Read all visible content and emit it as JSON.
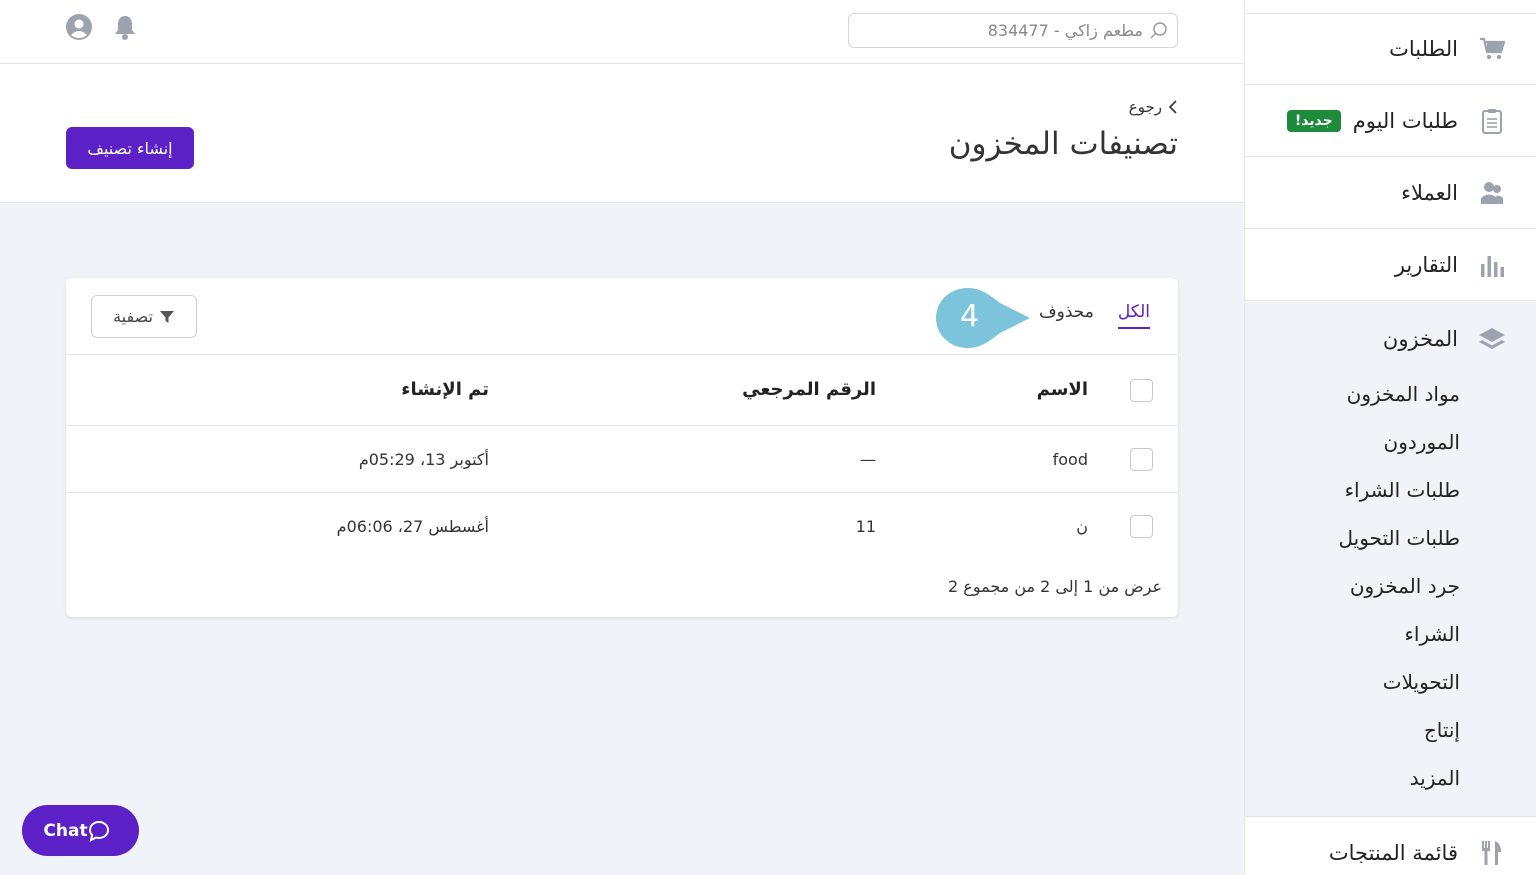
{
  "search": {
    "placeholder": "مطعم زاكي - 834477"
  },
  "topbar": {
    "notifications_icon": "bell-icon",
    "profile_icon": "user-circle-icon"
  },
  "header": {
    "back_label": "رجوع",
    "title": "تصنيفات المخزون",
    "create_button": "إنشاء تصنيف"
  },
  "tabs": [
    {
      "label": "الكل",
      "active": true
    },
    {
      "label": "محذوف",
      "active": false
    }
  ],
  "callout": {
    "number": "4",
    "color": "#7cc3dc"
  },
  "filter": {
    "label": "تصفية"
  },
  "table": {
    "columns": {
      "name": "الاسم",
      "reference": "الرقم المرجعي",
      "created": "تم الإنشاء"
    },
    "rows": [
      {
        "name": "food",
        "reference": "—",
        "created": "أكتوبر 13، 05:29م"
      },
      {
        "name": "ن",
        "reference": "11",
        "created": "أغسطس 27، 06:06م"
      }
    ],
    "footer": "عرض من 1 إلى 2 من مجموع 2"
  },
  "sidebar": {
    "items": [
      {
        "label": "الطلبات",
        "icon": "cart-icon"
      },
      {
        "label": "طلبات اليوم",
        "icon": "clipboard-icon",
        "badge": "جديد!"
      },
      {
        "label": "العملاء",
        "icon": "customers-icon"
      },
      {
        "label": "التقارير",
        "icon": "bar-chart-icon"
      }
    ],
    "inventory": {
      "label": "المخزون",
      "icon": "layers-icon",
      "subitems": [
        "مواد المخزون",
        "الموردون",
        "طلبات الشراء",
        "طلبات التحويل",
        "جرد المخزون",
        "الشراء",
        "التحويلات",
        "إنتاج",
        "المزيد"
      ]
    },
    "menu": {
      "label": "قائمة المنتجات",
      "icon": "utensils-icon"
    }
  },
  "chat": {
    "label": "Chat"
  },
  "colors": {
    "accent": "#5b21c7",
    "badge": "#1e8b3c",
    "icon": "#9ca3af"
  }
}
